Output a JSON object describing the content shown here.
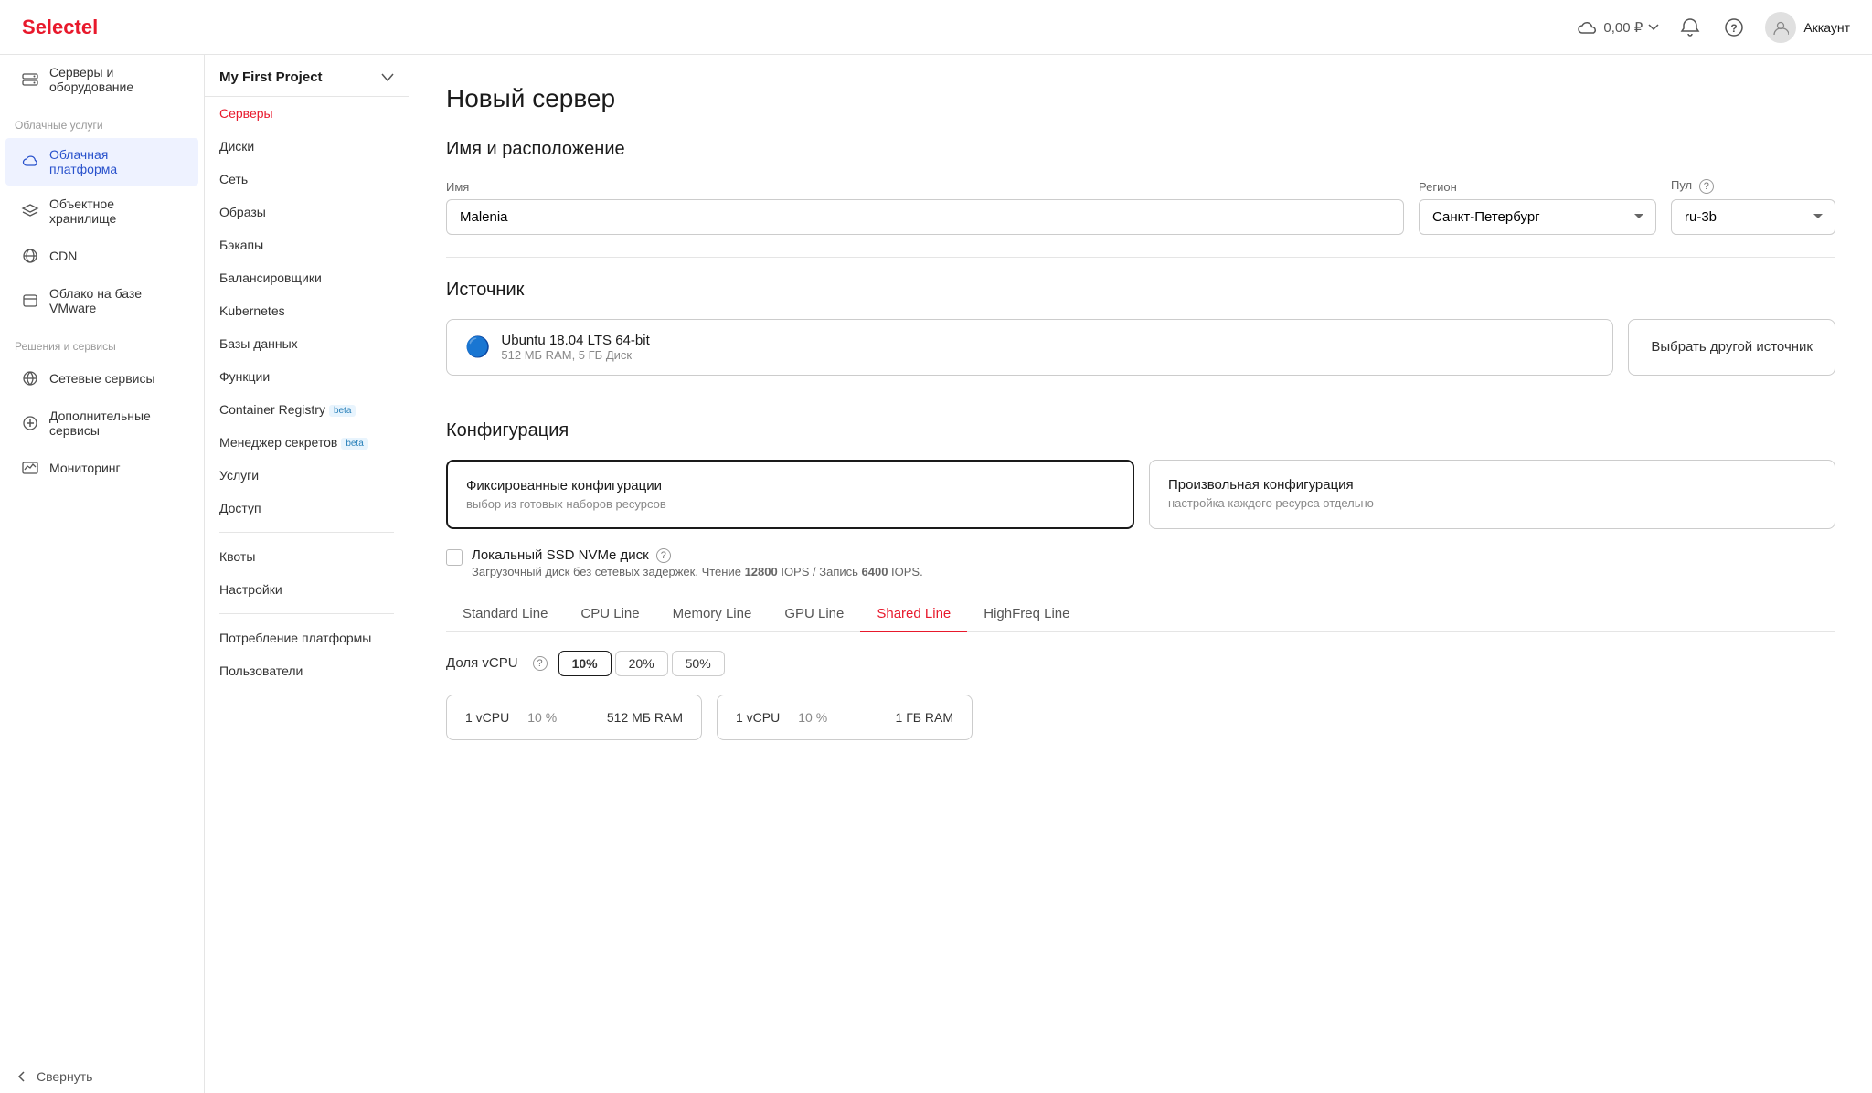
{
  "header": {
    "logo_text": "Selectel",
    "logo_accent": "el",
    "cost": "0,00 ₽",
    "account_label": "Аккаунт"
  },
  "sidebar_left": {
    "sections": [
      {
        "label": "",
        "items": [
          {
            "id": "servers",
            "label": "Серверы и оборудование",
            "icon": "server"
          }
        ]
      },
      {
        "label": "Облачные услуги",
        "items": [
          {
            "id": "cloud",
            "label": "Облачная платформа",
            "icon": "cloud",
            "active": true
          },
          {
            "id": "object",
            "label": "Объектное хранилище",
            "icon": "cube"
          },
          {
            "id": "cdn",
            "label": "CDN",
            "icon": "network"
          },
          {
            "id": "vmware",
            "label": "Облако на базе VMware",
            "icon": "vmware"
          }
        ]
      },
      {
        "label": "Решения и сервисы",
        "items": [
          {
            "id": "network-services",
            "label": "Сетевые сервисы",
            "icon": "globe"
          },
          {
            "id": "extra-services",
            "label": "Дополнительные сервисы",
            "icon": "plus-circle"
          },
          {
            "id": "monitoring",
            "label": "Мониторинг",
            "icon": "chart"
          }
        ]
      }
    ],
    "collapse_label": "Свернуть"
  },
  "sidebar_mid": {
    "project_name": "My First Project",
    "nav_items": [
      {
        "id": "servers",
        "label": "Серверы",
        "active": true
      },
      {
        "id": "disks",
        "label": "Диски"
      },
      {
        "id": "network",
        "label": "Сеть"
      },
      {
        "id": "images",
        "label": "Образы"
      },
      {
        "id": "backups",
        "label": "Бэкапы"
      },
      {
        "id": "balancers",
        "label": "Балансировщики"
      },
      {
        "id": "kubernetes",
        "label": "Kubernetes"
      },
      {
        "id": "databases",
        "label": "Базы данных"
      },
      {
        "id": "functions",
        "label": "Функции"
      },
      {
        "id": "container-registry",
        "label": "Container Registry",
        "badge": "beta"
      },
      {
        "id": "secrets",
        "label": "Менеджер секретов",
        "badge": "beta"
      },
      {
        "id": "services",
        "label": "Услуги"
      },
      {
        "id": "access",
        "label": "Доступ"
      }
    ],
    "section2_items": [
      {
        "id": "quotas",
        "label": "Квоты"
      },
      {
        "id": "settings",
        "label": "Настройки"
      }
    ],
    "section3_items": [
      {
        "id": "platform-consumption",
        "label": "Потребление платформы"
      },
      {
        "id": "users",
        "label": "Пользователи"
      }
    ]
  },
  "main": {
    "page_title": "Новый сервер",
    "name_section": {
      "title": "Имя и расположение",
      "name_label": "Имя",
      "name_value": "Malenia",
      "region_label": "Регион",
      "region_value": "Санкт-Петербург",
      "pool_label": "Пул",
      "pool_value": "ru-3b"
    },
    "source_section": {
      "title": "Источник",
      "source_icon": "🔵",
      "source_name": "Ubuntu 18.04 LTS 64-bit",
      "source_meta": "512 МБ RAM, 5 ГБ Диск",
      "alt_source_btn": "Выбрать другой источник"
    },
    "config_section": {
      "title": "Конфигурация",
      "fixed_title": "Фиксированные конфигурации",
      "fixed_sub": "выбор из готовых наборов ресурсов",
      "custom_title": "Произвольная конфигурация",
      "custom_sub": "настройка каждого ресурса отдельно",
      "checkbox_label": "Локальный SSD NVMe диск",
      "checkbox_sub": "Загрузочный диск без сетевых задержек. Чтение ",
      "iops_read_val": "12800",
      "iops_read_unit": " IOPS / Запись ",
      "iops_write_val": "6400",
      "iops_write_unit": " IOPS."
    },
    "tabs": [
      {
        "id": "standard",
        "label": "Standard Line"
      },
      {
        "id": "cpu",
        "label": "CPU Line"
      },
      {
        "id": "memory",
        "label": "Memory Line"
      },
      {
        "id": "gpu",
        "label": "GPU Line"
      },
      {
        "id": "shared",
        "label": "Shared Line",
        "active": true
      },
      {
        "id": "highfreq",
        "label": "HighFreq Line"
      }
    ],
    "vcpu_section": {
      "label": "Доля vCPU",
      "options": [
        "10%",
        "20%",
        "50%"
      ],
      "active_option": "10%"
    },
    "server_cards": [
      {
        "cpu": "1 vCPU",
        "pct": "10 %",
        "ram": "512 МБ RAM"
      },
      {
        "cpu": "1 vCPU",
        "pct": "10 %",
        "ram": "1 ГБ RAM"
      }
    ]
  }
}
